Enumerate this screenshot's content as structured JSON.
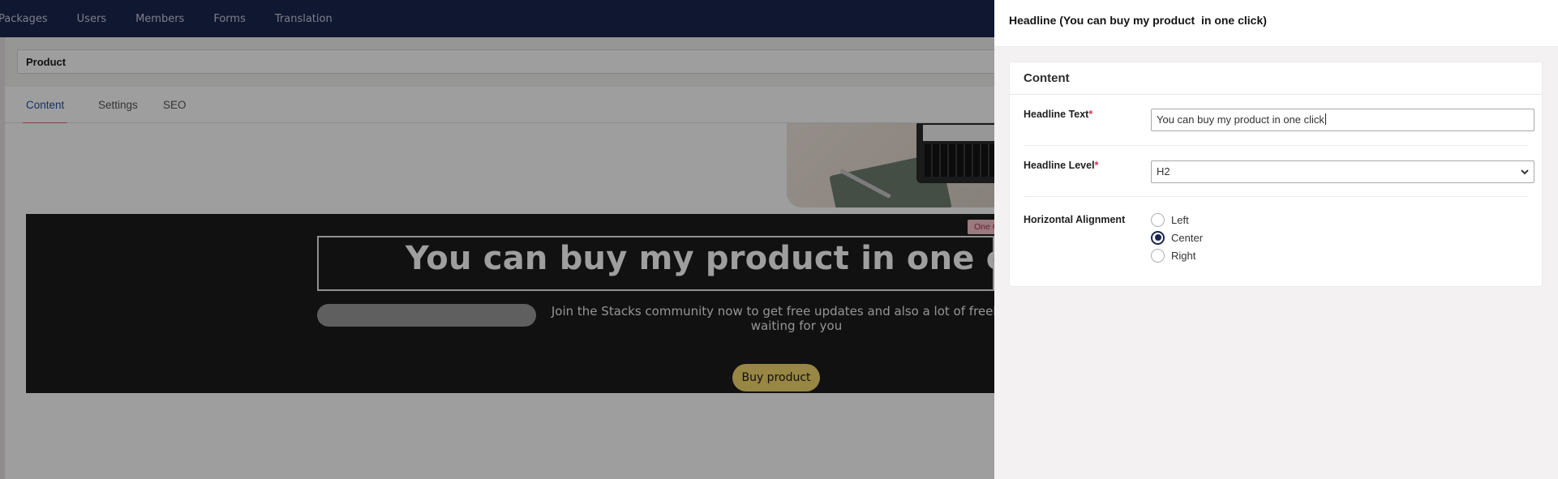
{
  "topnav": {
    "items": [
      "Packages",
      "Users",
      "Members",
      "Forms",
      "Translation"
    ]
  },
  "page": {
    "name_value": "Product",
    "tabs": [
      "Content",
      "Settings",
      "SEO"
    ],
    "active_tab": "Content"
  },
  "hero": {
    "badge": "One C",
    "headline": "You can buy my product  in one click",
    "text": "Join the Stacks community now to get free updates  and also a lot of freebies are waiting for you",
    "button_label": "Buy product",
    "button_color": "#f4d96f"
  },
  "panel": {
    "title": "Headline (You can buy my product  in one click)",
    "card_title": "Content",
    "headline_text": {
      "label": "Headline Text",
      "required_mark": "*",
      "value": "You can buy my product  in one click"
    },
    "headline_level": {
      "label": "Headline Level",
      "required_mark": "*",
      "value": "H2"
    },
    "horizontal_alignment": {
      "label": "Horizontal Alignment",
      "options": [
        "Left",
        "Center",
        "Right"
      ],
      "selected": "Center"
    }
  },
  "colors": {
    "nav_background": "#1b264f",
    "active_tab": "#2152a3",
    "tab_indicator": "#e06a7b",
    "required_mark": "#d0334a"
  }
}
